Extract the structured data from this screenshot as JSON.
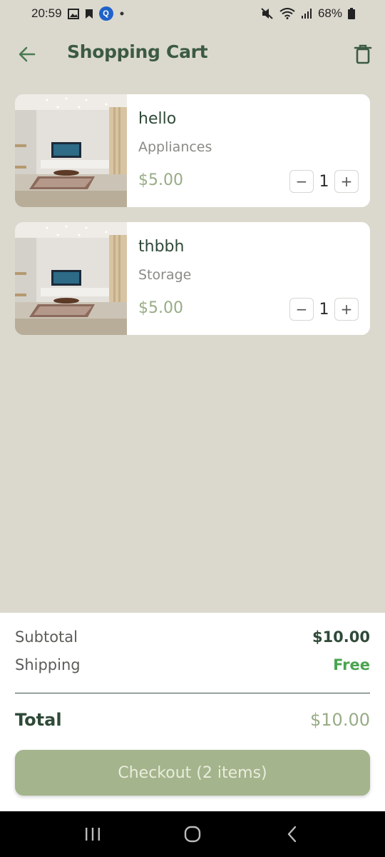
{
  "status_bar": {
    "time": "20:59",
    "battery": "68%",
    "icons_left": [
      "image-icon",
      "bookmark-icon",
      "app-badge-icon",
      "dot-icon"
    ],
    "icons_right": [
      "mute-icon",
      "wifi-icon",
      "signal-icon",
      "battery-icon"
    ]
  },
  "header": {
    "title": "Shopping Cart",
    "back_icon": "arrow-left-icon",
    "delete_icon": "trash-icon"
  },
  "cart": {
    "items": [
      {
        "name": "hello",
        "category": "Appliances",
        "price": "$5.00",
        "quantity": "1"
      },
      {
        "name": "thbbh",
        "category": "Storage",
        "price": "$5.00",
        "quantity": "1"
      }
    ],
    "decrement_label": "−",
    "increment_label": "+"
  },
  "summary": {
    "subtotal_label": "Subtotal",
    "subtotal_value": "$10.00",
    "shipping_label": "Shipping",
    "shipping_value": "Free",
    "total_label": "Total",
    "total_value": "$10.00",
    "checkout_label": "Checkout (2 items)"
  },
  "colors": {
    "background": "#dbd9ce",
    "accent": "#3c5a44",
    "price": "#98ac86",
    "free": "#4aa44e",
    "checkout": "#a4b48c"
  },
  "nav": [
    "recents-icon",
    "home-icon",
    "back-nav-icon"
  ]
}
